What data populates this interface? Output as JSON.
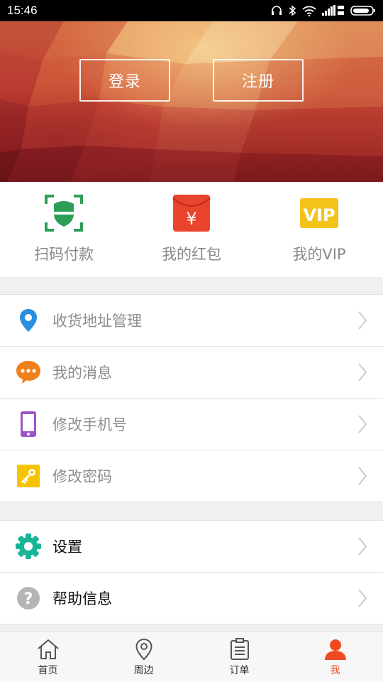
{
  "status_bar": {
    "time": "15:46"
  },
  "hero": {
    "login_label": "登录",
    "register_label": "注册"
  },
  "quick_actions": [
    {
      "label": "扫码付款",
      "icon": "scan-pay-icon",
      "color": "#2e9e57"
    },
    {
      "label": "我的红包",
      "icon": "red-packet-icon",
      "color": "#e9452e"
    },
    {
      "label": "我的VIP",
      "icon": "vip-icon",
      "color": "#f2c31a"
    }
  ],
  "menu_group_1": [
    {
      "label": "收货地址管理",
      "icon": "location-pin-icon",
      "color": "#2b8fe0"
    },
    {
      "label": "我的消息",
      "icon": "message-icon",
      "color": "#f0801c"
    },
    {
      "label": "修改手机号",
      "icon": "mobile-phone-icon",
      "color": "#9b55c8"
    },
    {
      "label": "修改密码",
      "icon": "key-icon",
      "color": "#f5c400"
    }
  ],
  "menu_group_2": [
    {
      "label": "设置",
      "icon": "gear-icon",
      "color": "#19b596"
    },
    {
      "label": "帮助信息",
      "icon": "help-icon",
      "color": "#b5b5b5"
    }
  ],
  "tabbar": [
    {
      "label": "首页",
      "icon": "home-icon"
    },
    {
      "label": "周边",
      "icon": "location-pin-icon"
    },
    {
      "label": "订单",
      "icon": "order-clipboard-icon"
    },
    {
      "label": "我",
      "icon": "user-icon",
      "active": true
    }
  ],
  "colors": {
    "accent": "#f04a23",
    "hero_base": "#c94a36"
  }
}
